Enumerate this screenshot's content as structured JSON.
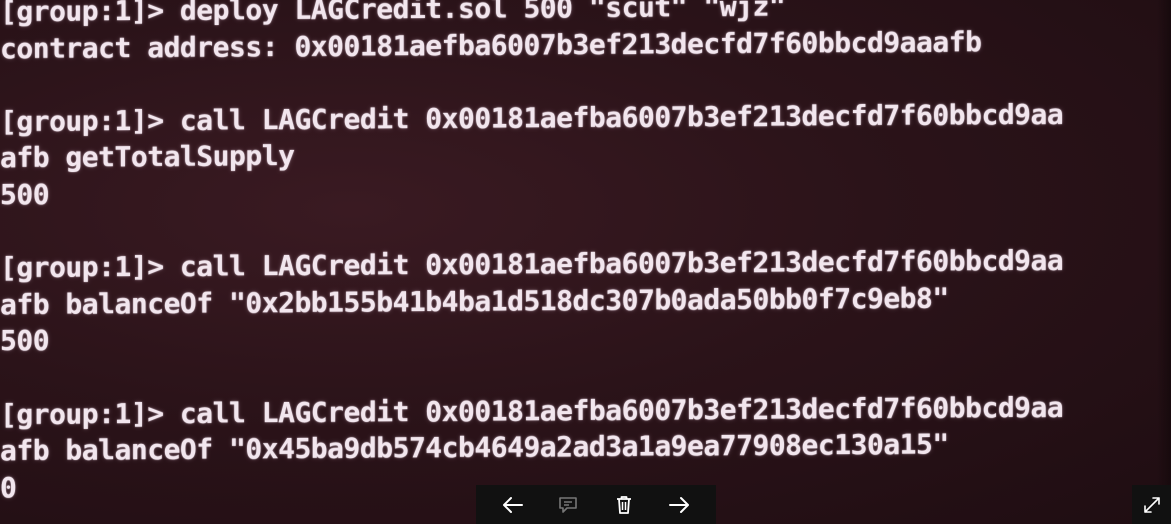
{
  "terminal": {
    "lines": [
      "[group:1]> deploy LAGCredit.sol 500 \"scut\" \"wjz\"",
      "contract address: 0x00181aefba6007b3ef213decfd7f60bbcd9aaafb",
      "",
      "[group:1]> call LAGCredit 0x00181aefba6007b3ef213decfd7f60bbcd9aa",
      "afb getTotalSupply",
      "500",
      "",
      "[group:1]> call LAGCredit 0x00181aefba6007b3ef213decfd7f60bbcd9aa",
      "afb balanceOf \"0x2bb155b41b4ba1d518dc307b0ada50bb0f7c9eb8\"",
      "500",
      "",
      "[group:1]> call LAGCredit 0x00181aefba6007b3ef213decfd7f60bbcd9aa",
      "afb balanceOf \"0x45ba9db574cb4649a2ad3a1a9ea77908ec130a15\"",
      "0"
    ]
  },
  "viewer_toolbar": {
    "icons": [
      "arrow-left-icon",
      "comment-icon",
      "trash-icon",
      "arrow-right-icon"
    ]
  },
  "expand": {
    "icon": "expand-icon"
  },
  "colors": {
    "terminal_text": "#f2e6ee",
    "terminal_background": "#2a1218",
    "toolbar_background": "#111111",
    "icon_color": "#ffffff"
  }
}
